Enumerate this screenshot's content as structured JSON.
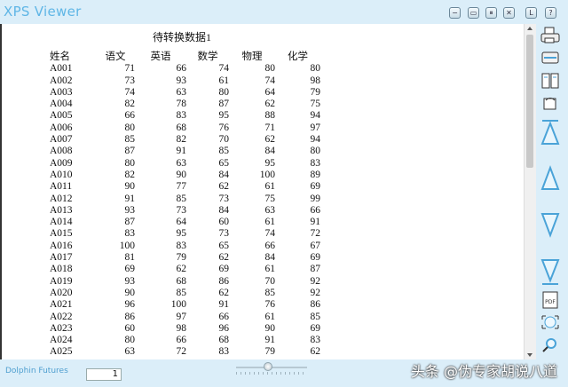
{
  "app": {
    "title": "XPS Viewer",
    "brand": "Dolphin Futures",
    "page_number": "1",
    "zoom_percent": 45
  },
  "titlebar_buttons": [
    {
      "name": "minimize-button",
      "glyph": "−"
    },
    {
      "name": "restore-button",
      "glyph": "▭"
    },
    {
      "name": "pause-button",
      "glyph": "⏸"
    },
    {
      "name": "close-button",
      "glyph": "✕"
    },
    {
      "name": "help-button",
      "glyph": "L"
    },
    {
      "name": "question-button",
      "glyph": "?"
    }
  ],
  "document": {
    "title": "待转换数据1",
    "headers": [
      "姓名",
      "语文",
      "英语",
      "数学",
      "物理",
      "化学"
    ],
    "rows": [
      [
        "A001",
        "71",
        "66",
        "74",
        "80",
        "80"
      ],
      [
        "A002",
        "73",
        "93",
        "61",
        "74",
        "98"
      ],
      [
        "A003",
        "74",
        "63",
        "80",
        "64",
        "79"
      ],
      [
        "A004",
        "82",
        "78",
        "87",
        "62",
        "75"
      ],
      [
        "A005",
        "66",
        "83",
        "95",
        "88",
        "94"
      ],
      [
        "A006",
        "80",
        "68",
        "76",
        "71",
        "97"
      ],
      [
        "A007",
        "85",
        "82",
        "70",
        "62",
        "94"
      ],
      [
        "A008",
        "87",
        "91",
        "85",
        "84",
        "80"
      ],
      [
        "A009",
        "80",
        "63",
        "65",
        "95",
        "83"
      ],
      [
        "A010",
        "82",
        "90",
        "84",
        "100",
        "89"
      ],
      [
        "A011",
        "90",
        "77",
        "62",
        "61",
        "69"
      ],
      [
        "A012",
        "91",
        "85",
        "73",
        "75",
        "99"
      ],
      [
        "A013",
        "93",
        "73",
        "84",
        "63",
        "66"
      ],
      [
        "A014",
        "87",
        "64",
        "60",
        "61",
        "91"
      ],
      [
        "A015",
        "83",
        "95",
        "73",
        "74",
        "72"
      ],
      [
        "A016",
        "100",
        "83",
        "65",
        "66",
        "67"
      ],
      [
        "A017",
        "81",
        "79",
        "62",
        "84",
        "69"
      ],
      [
        "A018",
        "69",
        "62",
        "69",
        "61",
        "87"
      ],
      [
        "A019",
        "93",
        "68",
        "86",
        "70",
        "92"
      ],
      [
        "A020",
        "90",
        "85",
        "62",
        "85",
        "92"
      ],
      [
        "A021",
        "96",
        "100",
        "91",
        "76",
        "86"
      ],
      [
        "A022",
        "86",
        "97",
        "66",
        "61",
        "85"
      ],
      [
        "A023",
        "60",
        "98",
        "96",
        "90",
        "69"
      ],
      [
        "A024",
        "80",
        "66",
        "68",
        "91",
        "83"
      ],
      [
        "A025",
        "63",
        "72",
        "83",
        "79",
        "62"
      ]
    ]
  },
  "watermark": "头条 @伪专家胡说八道",
  "colors": {
    "accent": "#5fb6e6",
    "background": "#dbeef9"
  }
}
